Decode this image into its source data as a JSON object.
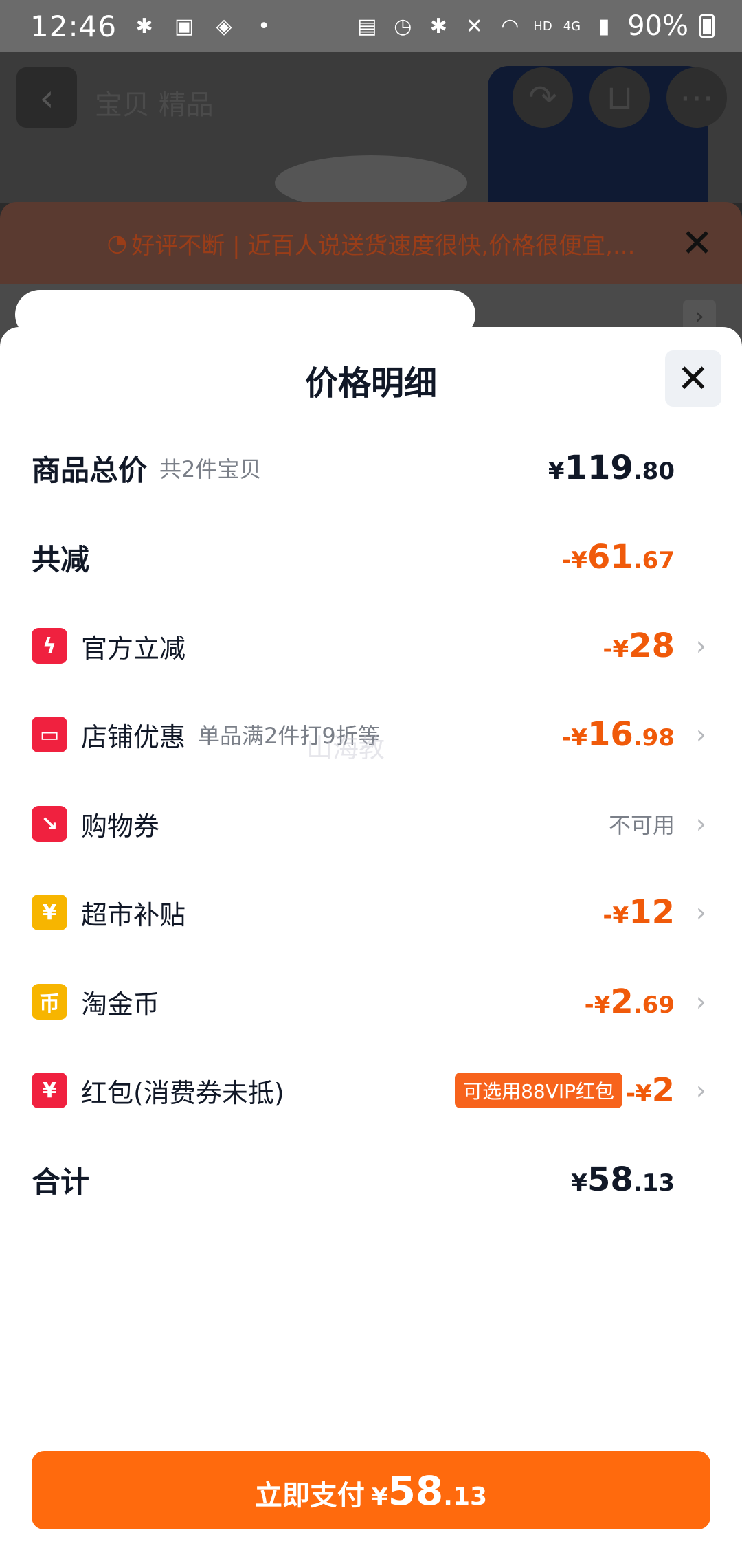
{
  "status_bar": {
    "time": "12:46",
    "battery": "90%",
    "network": "4G",
    "hd": "HD"
  },
  "background_page": {
    "title": "宝贝 精品",
    "banner_text": "好评不断 | 近百人说送货速度很快,价格很便宜,..."
  },
  "sheet": {
    "title": "价格明细",
    "total": {
      "label": "商品总价",
      "sub": "共2件宝贝",
      "yen": "¥",
      "int": "119",
      "dec": ".80"
    },
    "reduction": {
      "label": "共减",
      "yen": "-¥",
      "int": "61",
      "dec": ".67"
    },
    "items": [
      {
        "label": "官方立减",
        "sub": "",
        "icon": "lightning-icon",
        "yen": "-¥",
        "int": "28",
        "dec": ""
      },
      {
        "label": "店铺优惠",
        "sub": "单品满2件打9折等",
        "icon": "shop-icon",
        "yen": "-¥",
        "int": "16",
        "dec": ".98"
      },
      {
        "label": "购物券",
        "sub": "",
        "icon": "coupon-icon",
        "status": "不可用"
      },
      {
        "label": "超市补贴",
        "sub": "",
        "icon": "supermarket-icon",
        "yen": "-¥",
        "int": "12",
        "dec": ""
      },
      {
        "label": "淘金币",
        "sub": "",
        "icon": "coin-icon",
        "yen": "-¥",
        "int": "2",
        "dec": ".69"
      },
      {
        "label": "红包(消费券未抵)",
        "sub": "",
        "icon": "red-packet-icon",
        "badge": "可选用88VIP红包",
        "yen": "-¥",
        "int": "2",
        "dec": ""
      }
    ],
    "sum": {
      "label": "合计",
      "yen": "¥",
      "int": "58",
      "dec": ".13"
    },
    "watermark": "山海教"
  },
  "pay_button": {
    "label": "立即支付",
    "yen": "¥",
    "int": "58",
    "dec": ".13"
  },
  "colors": {
    "accent": "#ff6a0d",
    "discount": "#f05a0a",
    "icon_red": "#f0213f",
    "icon_yellow": "#f7b500"
  }
}
